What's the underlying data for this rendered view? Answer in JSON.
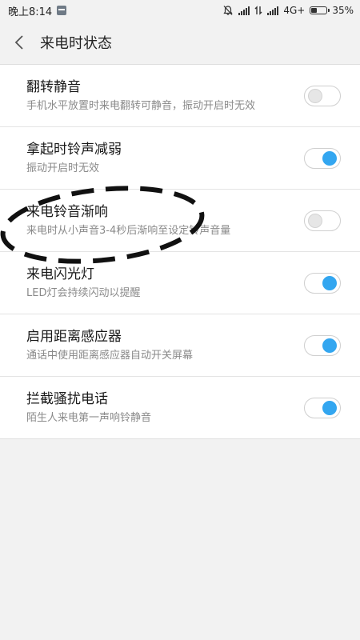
{
  "status_bar": {
    "time": "晚上8:14",
    "network": "4G+",
    "battery_text": "35%",
    "battery_level": 0.35,
    "icons": [
      "message-icon",
      "mute-icon",
      "signal-icon",
      "data-icon",
      "signal-icon",
      "battery-icon"
    ]
  },
  "header": {
    "title": "来电时状态"
  },
  "settings": [
    {
      "title": "翻转静音",
      "subtitle": "手机水平放置时来电翻转可静音，振动开启时无效",
      "on": false
    },
    {
      "title": "拿起时铃声减弱",
      "subtitle": "振动开启时无效",
      "on": true
    },
    {
      "title": "来电铃音渐响",
      "subtitle": "来电时从小声音3-4秒后渐响至设定铃声音量",
      "on": false
    },
    {
      "title": "来电闪光灯",
      "subtitle": "LED灯会持续闪动以提醒",
      "on": true
    },
    {
      "title": "启用距离感应器",
      "subtitle": "通话中使用距离感应器自动开关屏幕",
      "on": true
    },
    {
      "title": "拦截骚扰电话",
      "subtitle": "陌生人来电第一声响铃静音",
      "on": true
    }
  ],
  "colors": {
    "accent": "#33a6f0",
    "background": "#f2f2f2"
  }
}
